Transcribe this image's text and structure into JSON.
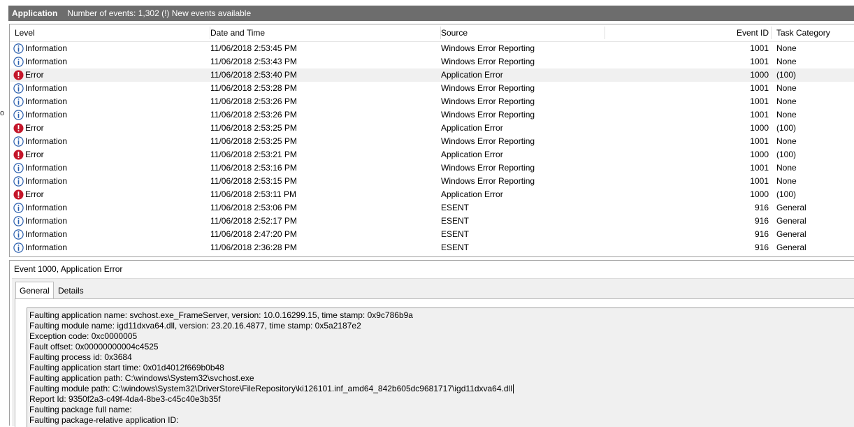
{
  "colors": {
    "title_bar": "#6d6d6d",
    "info_icon": "#2a5fae",
    "error_icon": "#c4162a",
    "selected_row": "#f0f0f0",
    "panel_bg": "#f0f0f0"
  },
  "window": {
    "clipped_left_char": "o",
    "title": "Application",
    "event_count": "Number of events: 1,302 (!) New events available"
  },
  "grid": {
    "headers": {
      "level": "Level",
      "datetime": "Date and Time",
      "source": "Source",
      "event_id": "Event ID",
      "task_category": "Task Category"
    },
    "rows": [
      {
        "level": "Information",
        "icon": "info-icon",
        "datetime": "11/06/2018 2:53:45 PM",
        "source": "Windows Error Reporting",
        "event_id": "1001",
        "task": "None"
      },
      {
        "level": "Information",
        "icon": "info-icon",
        "datetime": "11/06/2018 2:53:43 PM",
        "source": "Windows Error Reporting",
        "event_id": "1001",
        "task": "None"
      },
      {
        "level": "Error",
        "icon": "error-icon",
        "datetime": "11/06/2018 2:53:40 PM",
        "source": "Application Error",
        "event_id": "1000",
        "task": "(100)",
        "selected": true
      },
      {
        "level": "Information",
        "icon": "info-icon",
        "datetime": "11/06/2018 2:53:28 PM",
        "source": "Windows Error Reporting",
        "event_id": "1001",
        "task": "None"
      },
      {
        "level": "Information",
        "icon": "info-icon",
        "datetime": "11/06/2018 2:53:26 PM",
        "source": "Windows Error Reporting",
        "event_id": "1001",
        "task": "None"
      },
      {
        "level": "Information",
        "icon": "info-icon",
        "datetime": "11/06/2018 2:53:26 PM",
        "source": "Windows Error Reporting",
        "event_id": "1001",
        "task": "None"
      },
      {
        "level": "Error",
        "icon": "error-icon",
        "datetime": "11/06/2018 2:53:25 PM",
        "source": "Application Error",
        "event_id": "1000",
        "task": "(100)"
      },
      {
        "level": "Information",
        "icon": "info-icon",
        "datetime": "11/06/2018 2:53:25 PM",
        "source": "Windows Error Reporting",
        "event_id": "1001",
        "task": "None"
      },
      {
        "level": "Error",
        "icon": "error-icon",
        "datetime": "11/06/2018 2:53:21 PM",
        "source": "Application Error",
        "event_id": "1000",
        "task": "(100)"
      },
      {
        "level": "Information",
        "icon": "info-icon",
        "datetime": "11/06/2018 2:53:16 PM",
        "source": "Windows Error Reporting",
        "event_id": "1001",
        "task": "None"
      },
      {
        "level": "Information",
        "icon": "info-icon",
        "datetime": "11/06/2018 2:53:15 PM",
        "source": "Windows Error Reporting",
        "event_id": "1001",
        "task": "None"
      },
      {
        "level": "Error",
        "icon": "error-icon",
        "datetime": "11/06/2018 2:53:11 PM",
        "source": "Application Error",
        "event_id": "1000",
        "task": "(100)"
      },
      {
        "level": "Information",
        "icon": "info-icon",
        "datetime": "11/06/2018 2:53:06 PM",
        "source": "ESENT",
        "event_id": "916",
        "task": "General"
      },
      {
        "level": "Information",
        "icon": "info-icon",
        "datetime": "11/06/2018 2:52:17 PM",
        "source": "ESENT",
        "event_id": "916",
        "task": "General"
      },
      {
        "level": "Information",
        "icon": "info-icon",
        "datetime": "11/06/2018 2:47:20 PM",
        "source": "ESENT",
        "event_id": "916",
        "task": "General"
      },
      {
        "level": "Information",
        "icon": "info-icon",
        "datetime": "11/06/2018 2:36:28 PM",
        "source": "ESENT",
        "event_id": "916",
        "task": "General"
      }
    ]
  },
  "detail": {
    "header": "Event 1000, Application Error",
    "tabs": [
      "General",
      "Details"
    ],
    "active_tab": "General",
    "lines": [
      "Faulting application name: svchost.exe_FrameServer, version: 10.0.16299.15, time stamp: 0x9c786b9a",
      "Faulting module name: igd11dxva64.dll, version: 23.20.16.4877, time stamp: 0x5a2187e2",
      "Exception code: 0xc0000005",
      "Fault offset: 0x00000000004c4525",
      "Faulting process id: 0x3684",
      "Faulting application start time: 0x01d4012f669b0b48",
      "Faulting application path: C:\\windows\\System32\\svchost.exe",
      "Faulting module path: C:\\windows\\System32\\DriverStore\\FileRepository\\ki126101.inf_amd64_842b605dc9681717\\igd11dxva64.dll",
      "Report Id: 9350f2a3-c49f-4da4-8be3-c45c40e3b35f",
      "Faulting package full name:",
      "Faulting package-relative application ID:"
    ]
  }
}
